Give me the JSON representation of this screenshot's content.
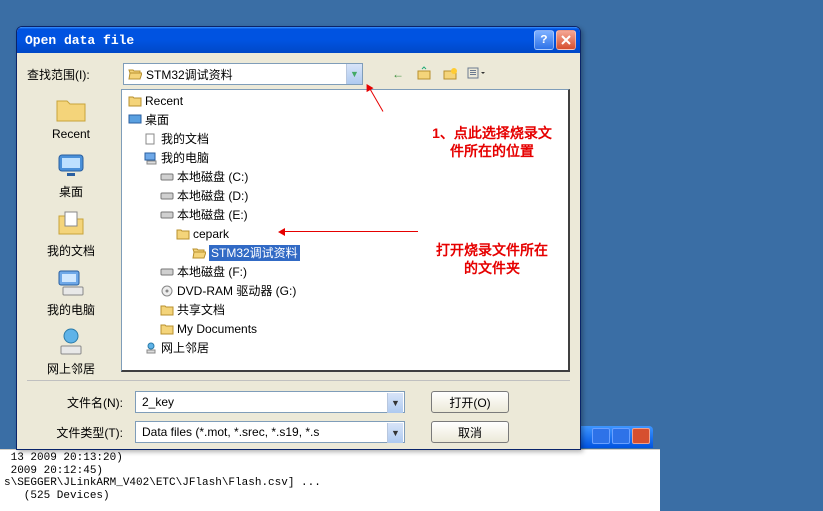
{
  "dialog": {
    "title": "Open data file",
    "look_in_label": "查找范围(I):",
    "look_in_value": "STM32调试资料",
    "tree": {
      "recent": "Recent",
      "desktop": "桌面",
      "mydocs": "我的文档",
      "mypc": "我的电脑",
      "disk_c": "本地磁盘 (C:)",
      "disk_d": "本地磁盘 (D:)",
      "disk_e": "本地磁盘 (E:)",
      "cepark": "cepark",
      "stm32": "STM32调试资料",
      "disk_f": "本地磁盘 (F:)",
      "dvd": "DVD-RAM 驱动器 (G:)",
      "shared": "共享文档",
      "mydocuments": "My Documents",
      "network": "网上邻居"
    },
    "sidebar": {
      "recent": "Recent",
      "desktop": "桌面",
      "mydocs": "我的文档",
      "mypc": "我的电脑",
      "network": "网上邻居"
    },
    "filename_label": "文件名(N):",
    "filename_value": "2_key",
    "filetype_label": "文件类型(T):",
    "filetype_value": "Data files (*.mot, *.srec, *.s19, *.s",
    "open_btn": "打开(O)",
    "cancel_btn": "取消"
  },
  "annotations": {
    "a1": "1、点此选择烧录文\n件所在的位置",
    "a2": "打开烧录文件所在\n的文件夹"
  },
  "console": " 13 2009 20:13:20)\n 2009 20:12:45)\ns\\SEGGER\\JLinkARM_V402\\ETC\\JFlash\\Flash.csv] ...\n   (525 Devices)"
}
